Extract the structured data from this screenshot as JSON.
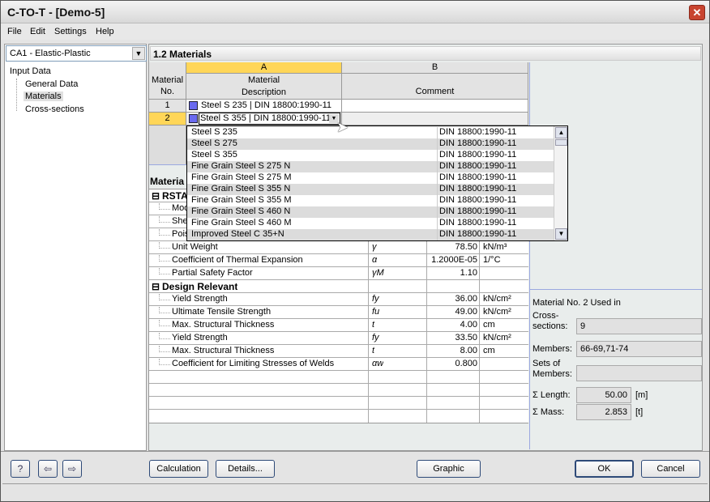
{
  "window": {
    "title": "C-TO-T - [Demo-5]",
    "close": "✕"
  },
  "menu": [
    "File",
    "Edit",
    "Settings",
    "Help"
  ],
  "left": {
    "combo": "CA1 - Elastic-Plastic",
    "tree_root": "Input Data",
    "items": [
      "General Data",
      "Materials",
      "Cross-sections"
    ],
    "selected": "Materials"
  },
  "section_title": "1.2 Materials",
  "table": {
    "col_letters": [
      "A",
      "B"
    ],
    "header_no": [
      "Material",
      "No."
    ],
    "header_desc": [
      "Material",
      "Description"
    ],
    "header_comment": "Comment",
    "rows": [
      {
        "no": "1",
        "desc": "Steel S 235 | DIN 18800:1990-11",
        "comment": ""
      },
      {
        "no": "2",
        "desc": "Steel S 355 | DIN 18800:1990-11",
        "comment": ""
      }
    ],
    "material_color": "#6a6af0"
  },
  "dropdown": {
    "items": [
      {
        "name": "Steel S 235",
        "norm": "DIN 18800:1990-11"
      },
      {
        "name": "Steel S 275",
        "norm": "DIN 18800:1990-11"
      },
      {
        "name": "Steel S 355",
        "norm": "DIN 18800:1990-11"
      },
      {
        "name": "Fine Grain Steel S 275 N",
        "norm": "DIN 18800:1990-11"
      },
      {
        "name": "Fine Grain Steel S 275 M",
        "norm": "DIN 18800:1990-11"
      },
      {
        "name": "Fine Grain Steel S 355 N",
        "norm": "DIN 18800:1990-11"
      },
      {
        "name": "Fine Grain Steel S 355 M",
        "norm": "DIN 18800:1990-11"
      },
      {
        "name": "Fine Grain Steel S 460 N",
        "norm": "DIN 18800:1990-11"
      },
      {
        "name": "Fine Grain Steel S 460 M",
        "norm": "DIN 18800:1990-11"
      },
      {
        "name": "Improved Steel C 35+N",
        "norm": "DIN 18800:1990-11"
      }
    ]
  },
  "props": {
    "title": "Materia",
    "group1": "RSTA",
    "group1_rows": [
      {
        "label": "Mod",
        "sym": "",
        "val": "",
        "unit": ""
      },
      {
        "label": "She",
        "sym": "",
        "val": "",
        "unit": ""
      },
      {
        "label": "Pois",
        "sym": "",
        "val": "",
        "unit": ""
      },
      {
        "label": "Unit Weight",
        "sym": "γ",
        "val": "78.50",
        "unit": "kN/m³"
      },
      {
        "label": "Coefficient of Thermal Expansion",
        "sym": "α",
        "val": "1.2000E-05",
        "unit": "1/°C"
      },
      {
        "label": "Partial Safety Factor",
        "sym": "γM",
        "val": "1.10",
        "unit": ""
      }
    ],
    "group2": "Design Relevant",
    "group2_rows": [
      {
        "label": "Yield Strength",
        "sym": "fy",
        "val": "36.00",
        "unit": "kN/cm²"
      },
      {
        "label": "Ultimate Tensile Strength",
        "sym": "fu",
        "val": "49.00",
        "unit": "kN/cm²"
      },
      {
        "label": "Max. Structural Thickness",
        "sym": "t",
        "val": "4.00",
        "unit": "cm"
      },
      {
        "label": "Yield Strength",
        "sym": "fy",
        "val": "33.50",
        "unit": "kN/cm²"
      },
      {
        "label": "Max. Structural Thickness",
        "sym": "t",
        "val": "8.00",
        "unit": "cm"
      },
      {
        "label": "Coefficient for Limiting Stresses of Welds",
        "sym": "αw",
        "val": "0.800",
        "unit": ""
      }
    ]
  },
  "usage": {
    "title": "Material No. 2 Used in",
    "cs_label": [
      "Cross-",
      "sections:"
    ],
    "cs": "9",
    "members_label": "Members:",
    "members": "66-69,71-74",
    "sets_label": [
      "Sets of",
      "Members:"
    ],
    "sets": "",
    "length_label": "Σ Length:",
    "length": "50.00",
    "length_unit": "[m]",
    "mass_label": "Σ Mass:",
    "mass": "2.853",
    "mass_unit": "[t]"
  },
  "buttons": {
    "calculation": "Calculation",
    "details": "Details...",
    "graphic": "Graphic",
    "ok": "OK",
    "cancel": "Cancel"
  }
}
